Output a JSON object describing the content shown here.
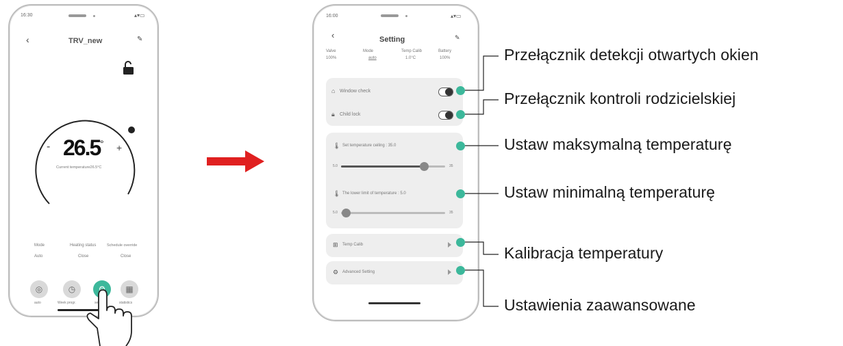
{
  "colors": {
    "accent": "#3cb89b",
    "arrow": "#e02020",
    "leader": "#222222"
  },
  "left_phone": {
    "time": "16:30",
    "title": "TRV_new",
    "temperature": "26.5",
    "temp_unit": "°",
    "current_temp": "Current temperature26.5°C",
    "stats": [
      {
        "label": "Mode",
        "value": "Auto"
      },
      {
        "label": "Heating status",
        "value": "Close"
      },
      {
        "label": "Schedule override",
        "value": "Close"
      }
    ],
    "nav": [
      "auto",
      "Week progr.",
      "setting",
      "statistics"
    ]
  },
  "right_phone": {
    "time": "16:00",
    "title": "Setting",
    "header_stats": [
      {
        "label": "Valve",
        "value": "100%"
      },
      {
        "label": "Mode",
        "value": "auto"
      },
      {
        "label": "Temp Calib",
        "value": "1.0°C"
      },
      {
        "label": "Battery",
        "value": "100%"
      }
    ],
    "rows": {
      "window_check": "Window check",
      "child_lock": "Child lock",
      "max_temp": "Set temperature ceiling : 35.0",
      "min_temp": "The lower limit of temperature : 5.0",
      "temp_calib": "Temp Calib",
      "advanced": "Advanced Setting"
    },
    "slider_ends": {
      "max_low": "5.0",
      "max_high": "35",
      "min_low": "5.0",
      "min_high": "35"
    },
    "slider_values": {
      "max_fraction": 0.8,
      "min_fraction": 0.05
    }
  },
  "annotations": [
    "Przełącznik detekcji otwartych okien",
    "Przełącznik kontroli rodzicielskiej",
    "Ustaw maksymalną temperaturę",
    "Ustaw minimalną temperaturę",
    "Kalibracja temperatury",
    "Ustawienia zaawansowane"
  ]
}
